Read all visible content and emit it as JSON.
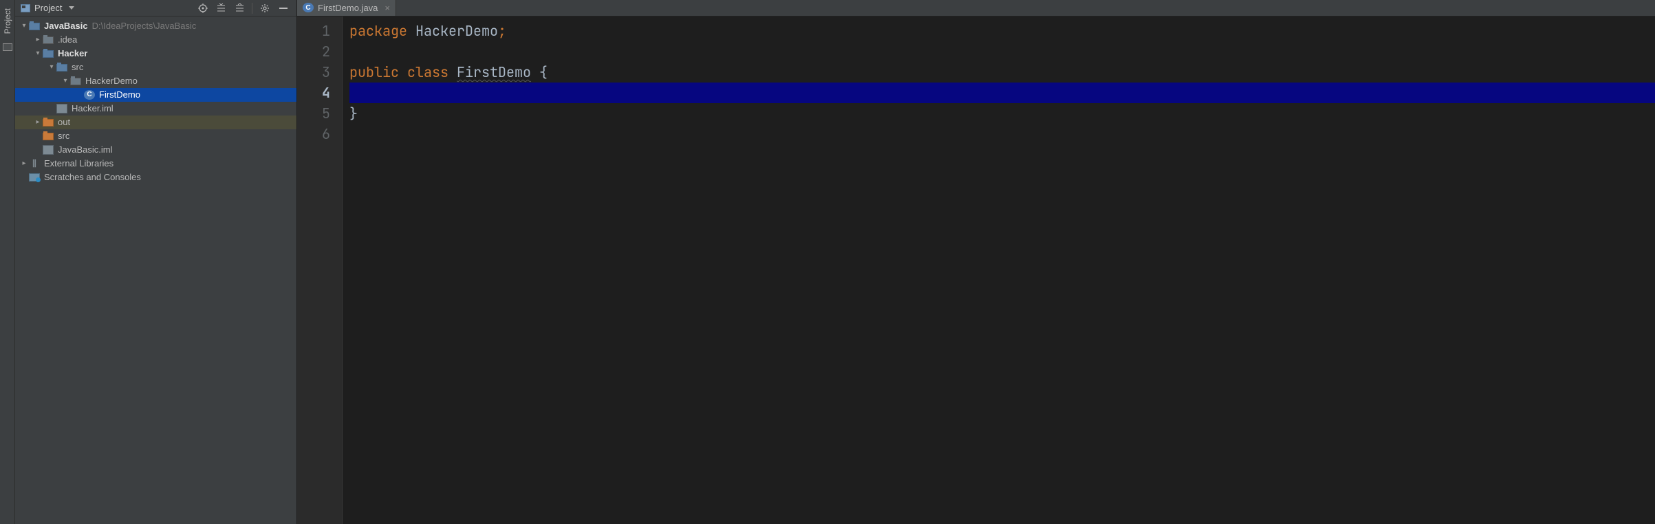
{
  "left_gutter": {
    "label": "Project"
  },
  "sidebar": {
    "title": "Project",
    "tree": {
      "root": {
        "name": "JavaBasic",
        "path": "D:\\IdeaProjects\\JavaBasic"
      },
      "idea": ".idea",
      "hacker": "Hacker",
      "src1": "src",
      "hackerdemo": "HackerDemo",
      "firstdemo": "FirstDemo",
      "hackeriml": "Hacker.iml",
      "out": "out",
      "src2": "src",
      "javabasiciml": "JavaBasic.iml",
      "extlib": "External Libraries",
      "scratch": "Scratches and Consoles"
    }
  },
  "editor": {
    "tab": {
      "name": "FirstDemo.java"
    },
    "gutter": [
      "1",
      "2",
      "3",
      "4",
      "5",
      "6"
    ],
    "code": {
      "l1": {
        "kw": "package",
        "sp": " ",
        "rest": "HackerDemo",
        "semi": ";"
      },
      "l3": {
        "kw1": "public",
        "sp1": " ",
        "kw2": "class",
        "sp2": " ",
        "cls": "FirstDemo",
        "sp3": " ",
        "brace": "{"
      },
      "l5": "}"
    }
  }
}
